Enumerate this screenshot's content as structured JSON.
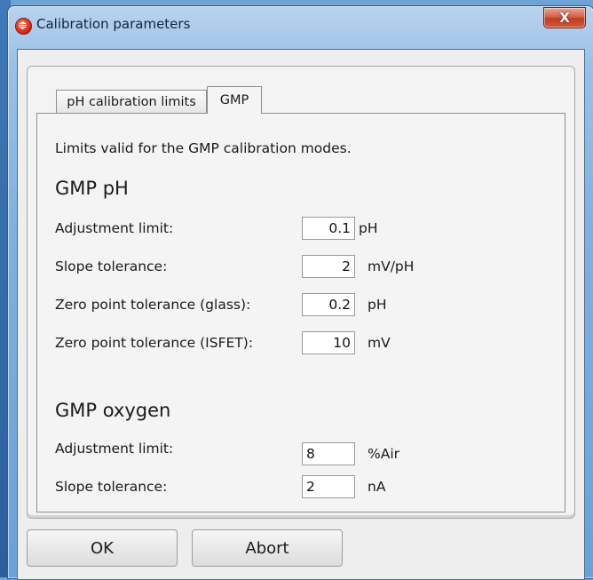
{
  "window": {
    "title": "Calibration parameters",
    "close_label": "X"
  },
  "tabs": [
    {
      "label": "pH calibration limits",
      "selected": false
    },
    {
      "label": "GMP",
      "selected": true
    }
  ],
  "panel": {
    "description": "Limits valid for the GMP calibration modes.",
    "gmp_ph": {
      "heading": "GMP pH",
      "rows": [
        {
          "label": "Adjustment limit:",
          "value": "0.1",
          "unit": "pH"
        },
        {
          "label": "Slope tolerance:",
          "value": "2",
          "unit": "mV/pH"
        },
        {
          "label": "Zero point tolerance (glass):",
          "value": "0.2",
          "unit": "pH"
        },
        {
          "label": "Zero point tolerance (ISFET):",
          "value": "10",
          "unit": "mV"
        }
      ]
    },
    "gmp_oxygen": {
      "heading": "GMP oxygen",
      "rows": [
        {
          "label": "Adjustment limit:",
          "value": "8",
          "unit": "%Air"
        },
        {
          "label": "Slope tolerance:",
          "value": "2",
          "unit": "nA"
        }
      ]
    }
  },
  "buttons": {
    "ok": "OK",
    "abort": "Abort"
  },
  "colors": {
    "title_bar": "#7fb0e0",
    "close_button": "#c23b21",
    "dialog_background": "#eeeeee"
  },
  "icons": {
    "app": "calibration-app-icon",
    "close": "close-icon"
  }
}
